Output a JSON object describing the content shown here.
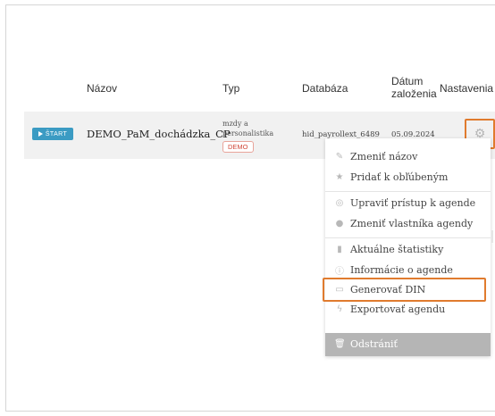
{
  "table": {
    "headers": {
      "name": "Názov",
      "type": "Typ",
      "database": "Databáza",
      "date_line1": "Dátum",
      "date_line2": "založenia",
      "settings": "Nastavenia"
    },
    "row": {
      "start_label": "ŠTART",
      "name": "DEMO_PaM_dochádzka_CP",
      "type_line1": "mzdy a",
      "type_line2": "personalistika",
      "badge": "DEMO",
      "database": "hid_payrollext_6489",
      "date": "05.09.2024"
    }
  },
  "menu": {
    "items": [
      {
        "label": "Zmeniť názov",
        "icon": "pencil-icon"
      },
      {
        "label": "Pridať k obľúbeným",
        "icon": "star-icon"
      },
      {
        "label": "Upraviť prístup k agende",
        "icon": "access-icon"
      },
      {
        "label": "Zmeniť vlastníka agendy",
        "icon": "user-icon"
      },
      {
        "label": "Aktuálne štatistiky",
        "icon": "bar-chart-icon"
      },
      {
        "label": "Informácie o agende",
        "icon": "info-icon"
      },
      {
        "label": "Generovať DIN",
        "icon": "document-icon"
      },
      {
        "label": "Exportovať agendu",
        "icon": "bolt-icon"
      }
    ],
    "delete_label": "Odstrániť"
  },
  "colors": {
    "accent": "#3b9bc3",
    "highlight": "#e07b2e",
    "badge": "#d0493a"
  }
}
